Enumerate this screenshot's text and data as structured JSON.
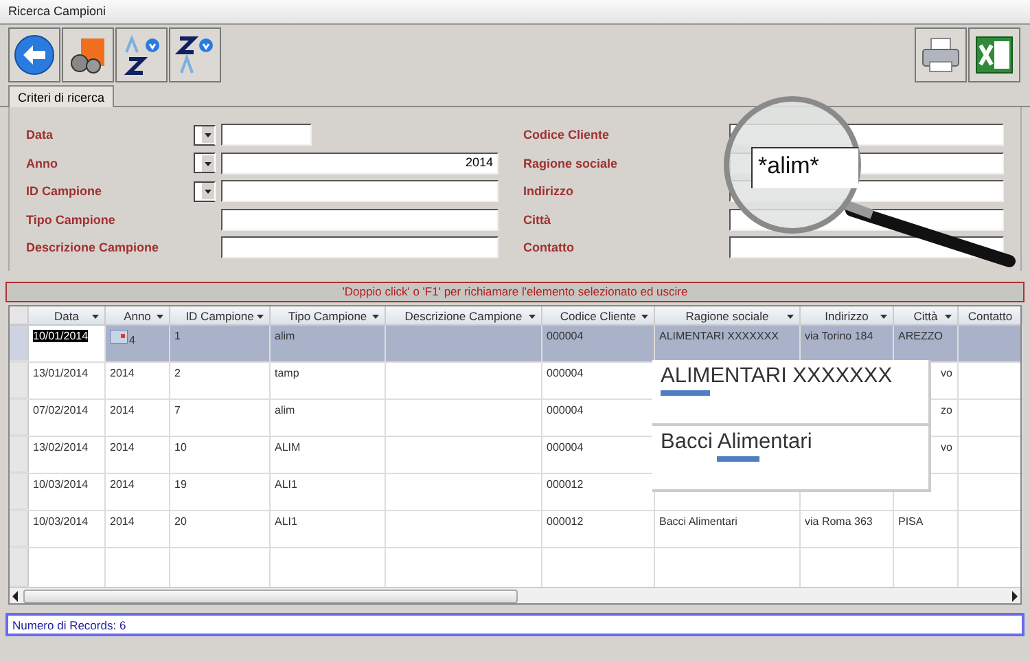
{
  "window": {
    "title": "Ricerca Campioni"
  },
  "tabs": [
    {
      "label": "Criteri di ricerca",
      "selected": true
    }
  ],
  "left_fields": [
    {
      "label": "Data",
      "combo": true,
      "short": true
    },
    {
      "label": "Anno",
      "combo": true,
      "value": "2014",
      "short": false
    },
    {
      "label": "ID Campione",
      "combo": true,
      "short": false
    },
    {
      "label": "Tipo Campione",
      "combo": false,
      "short": false
    },
    {
      "label": "Descrizione Campione",
      "combo": false,
      "short": false
    }
  ],
  "right_fields": [
    {
      "label": "Codice Cliente"
    },
    {
      "label": "Ragione sociale"
    },
    {
      "label": "Indirizzo"
    },
    {
      "label": "Città"
    },
    {
      "label": "Contatto"
    }
  ],
  "magnifier": {
    "text": "*alim*"
  },
  "hint": "'Doppio click' o 'F1' per richiamare l'elemento selezionato ed uscire",
  "table": {
    "columns": [
      "Data",
      "Anno",
      "ID Campione",
      "Tipo Campione",
      "Descrizione Campione",
      "Codice Cliente",
      "Ragione sociale",
      "Indirizzo",
      "Città",
      "Contatto"
    ],
    "rows": [
      {
        "selected": true,
        "cells": [
          "10/01/2014",
          "4",
          "1",
          "alim",
          "",
          "000004",
          "ALIMENTARI XXXXXXX",
          "via Torino 184",
          "AREZZO",
          ""
        ]
      },
      {
        "selected": false,
        "cells": [
          "13/01/2014",
          "2014",
          "2",
          "tamp",
          "",
          "000004",
          "",
          "",
          "vo",
          ""
        ]
      },
      {
        "selected": false,
        "cells": [
          "07/02/2014",
          "2014",
          "7",
          "alim",
          "",
          "000004",
          "",
          "",
          "zo",
          ""
        ]
      },
      {
        "selected": false,
        "cells": [
          "13/02/2014",
          "2014",
          "10",
          "ALIM",
          "",
          "000004",
          "",
          "",
          "vo",
          ""
        ]
      },
      {
        "selected": false,
        "cells": [
          "10/03/2014",
          "2014",
          "19",
          "ALI1",
          "",
          "000012",
          "",
          "",
          "",
          ""
        ]
      },
      {
        "selected": false,
        "cells": [
          "10/03/2014",
          "2014",
          "20",
          "ALI1",
          "",
          "000012",
          "Bacci Alimentari",
          "via Roma 363",
          "PISA",
          ""
        ]
      }
    ]
  },
  "callout": [
    {
      "match": "ALIM",
      "after": "ENTARI XXXXXXX"
    },
    {
      "before": "Bacci ",
      "match": "Alim",
      "after": "entari"
    }
  ],
  "status_bar": "Numero di Records: 6"
}
